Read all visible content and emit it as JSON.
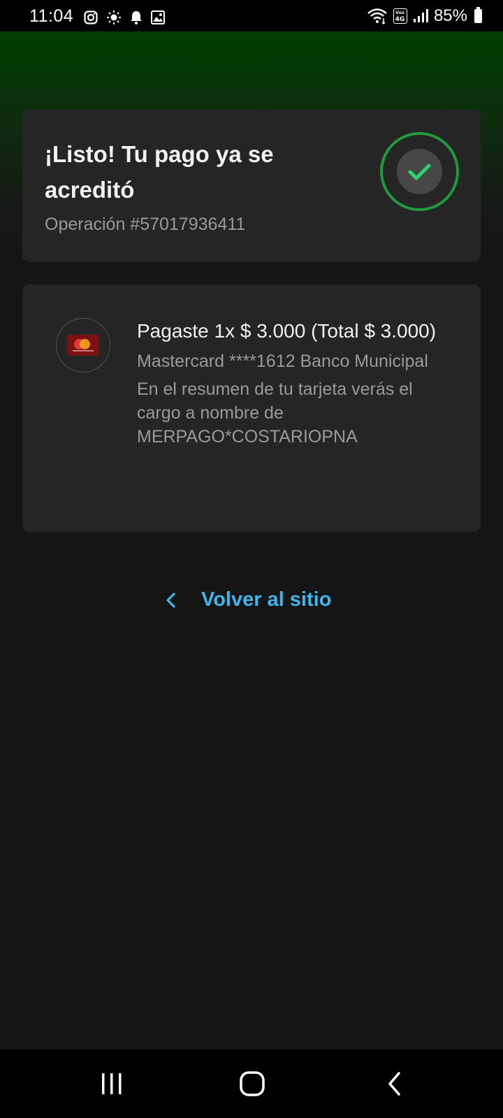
{
  "status_bar": {
    "time": "11:04",
    "battery": "85%",
    "network_badge": "Voz 4G"
  },
  "success_card": {
    "title": "¡Listo! Tu pago ya se acreditó",
    "operation": "Operación #57017936411",
    "status_icon": "check-icon",
    "accent_color": "#1f9a3d"
  },
  "payment_card": {
    "amount": "Pagaste 1x $ 3.000 (Total $ 3.000)",
    "card_info": "Mastercard ****1612 Banco Municipal",
    "statement_note": "En el resumen de tu tarjeta verás el cargo a nombre de MERPAGO*COSTARIOPNA",
    "card_icon": "mastercard-icon"
  },
  "back_link": {
    "label": "Volver al sitio",
    "color": "#3fb6ee"
  },
  "nav_bar": {
    "buttons": [
      "recent-apps",
      "home",
      "back"
    ]
  }
}
